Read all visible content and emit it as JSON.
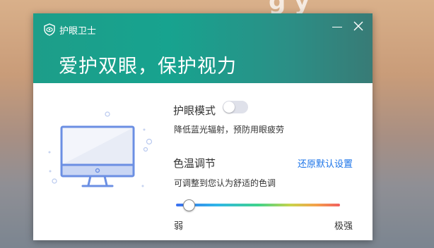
{
  "window": {
    "app_title": "护眼卫士",
    "headline": "爱护双眼，保护视力"
  },
  "eye_mode": {
    "label": "护眼模式",
    "enabled": false,
    "description": "降低蓝光辐射，预防用眼疲劳"
  },
  "color_temp": {
    "label": "色温调节",
    "reset_label": "还原默认设置",
    "description": "可调整到您认为舒适的色调",
    "level": 0.08,
    "min_label": "弱",
    "max_label": "极强"
  },
  "colors": {
    "header_start": "#1d9e89",
    "header_end": "#387b76",
    "link": "#1a73e8",
    "illustration": "#6b8fe3"
  }
}
